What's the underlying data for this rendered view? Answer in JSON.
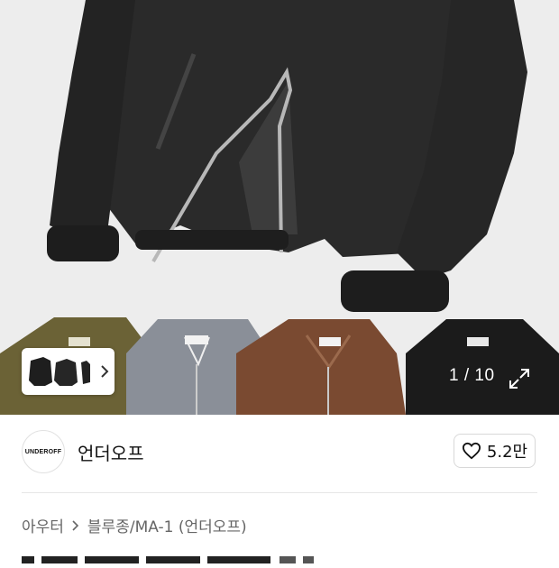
{
  "gallery": {
    "current": "1",
    "separator": "/",
    "total": "10",
    "expand_icon": "expand-arrows-icon",
    "similar_icon": "chevron-right-icon"
  },
  "brand": {
    "logo_text": "UNDEROFF",
    "name": "언더오프",
    "like_count": "5.2만",
    "like_icon": "heart-outline-icon"
  },
  "breadcrumb": {
    "items": [
      "아우터",
      "블루종/MA-1 (언더오프)"
    ],
    "separator_icon": "chevron-right-icon"
  },
  "colors": {
    "hero_bg": "#ededed",
    "olive": "#6b6236",
    "gray": "#8a8f98",
    "brown": "#7a4a31",
    "black": "#1b1b1b"
  }
}
